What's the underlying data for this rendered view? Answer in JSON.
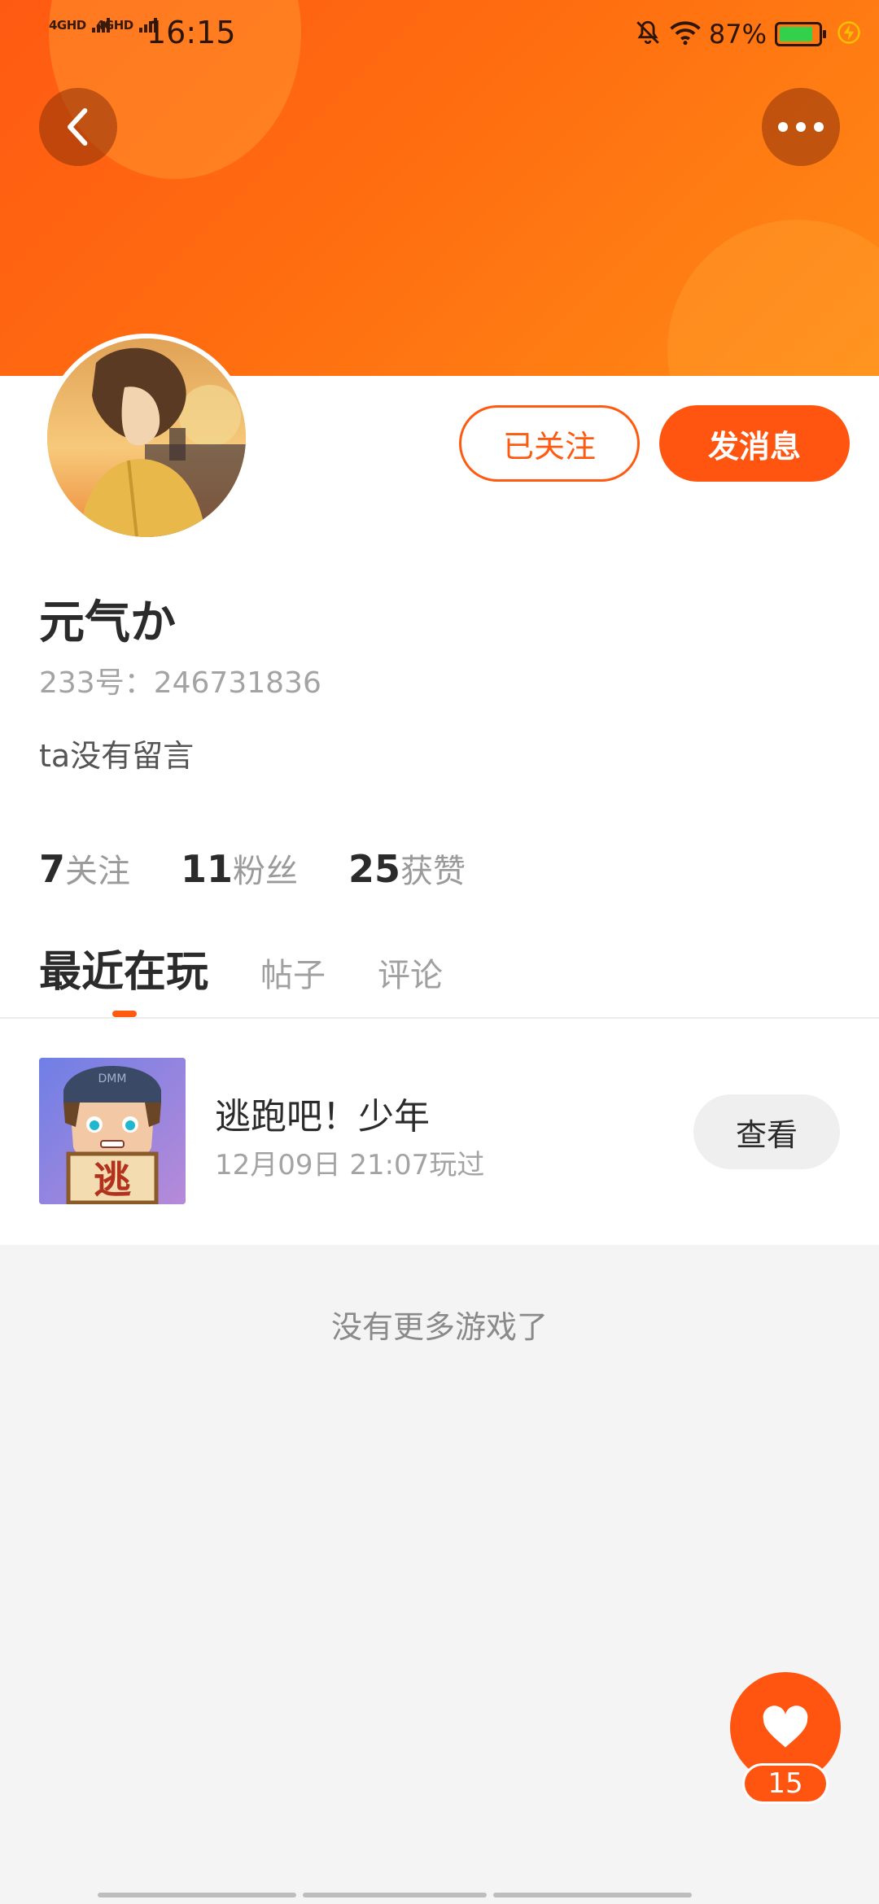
{
  "status_bar": {
    "network1": "4GHD",
    "network2": "4GHD",
    "time": "16:15",
    "battery_percent": "87%",
    "battery_level": 0.87,
    "icons": [
      "signal-bars-icon",
      "mute-bell-icon",
      "wifi-icon",
      "battery-icon",
      "charging-icon"
    ]
  },
  "header": {
    "back_icon": "chevron-left-icon",
    "more_icon": "more-dots-icon"
  },
  "profile": {
    "follow_label": "已关注",
    "message_label": "发消息",
    "username": "元气か",
    "uid": "233号：246731836",
    "bio": "ta没有留言"
  },
  "stats": [
    {
      "value": "7",
      "label": "关注"
    },
    {
      "value": "11",
      "label": "粉丝"
    },
    {
      "value": "25",
      "label": "获赞"
    }
  ],
  "tabs": [
    {
      "label": "最近在玩",
      "active": true
    },
    {
      "label": "帖子",
      "active": false
    },
    {
      "label": "评论",
      "active": false
    }
  ],
  "game": {
    "icon_text": "逃",
    "cap_text": "DMM",
    "title": "逃跑吧！少年",
    "played_at": "12月09日 21:07玩过",
    "view_label": "查看"
  },
  "no_more": "没有更多游戏了",
  "like": {
    "icon": "heart-icon",
    "count": "15"
  },
  "colors": {
    "accent": "#ff5510",
    "battery_green": "#33d04c"
  }
}
